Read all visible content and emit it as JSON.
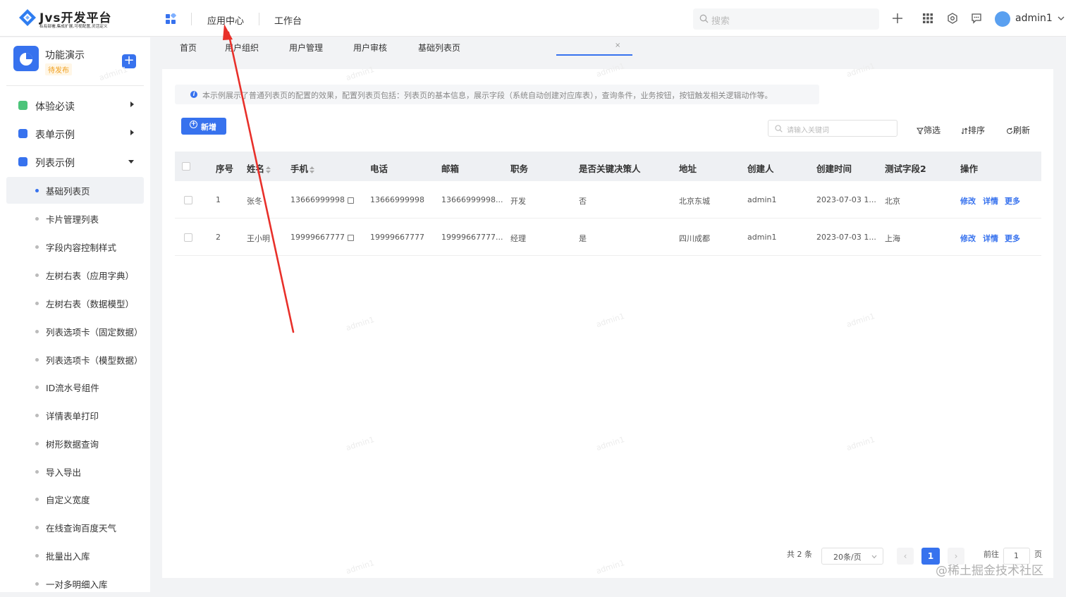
{
  "header": {
    "logo_title": "Jvs开发平台",
    "logo_subtitle": "私有部署,集成扩展,可视配置,灵活定义",
    "nav": [
      "应用中心",
      "工作台"
    ],
    "search_placeholder": "搜索",
    "username": "admin1"
  },
  "sidebar": {
    "app_name": "功能演示",
    "app_status": "待发布",
    "add_label": "+",
    "groups": [
      {
        "label": "体验必读",
        "color": "#4cc47a"
      },
      {
        "label": "表单示例",
        "color": "#3772ee"
      },
      {
        "label": "列表示例",
        "color": "#3772ee"
      }
    ],
    "items": [
      {
        "label": "基础列表页",
        "active": true
      },
      {
        "label": "卡片管理列表"
      },
      {
        "label": "字段内容控制样式"
      },
      {
        "label": "左树右表（应用字典）"
      },
      {
        "label": "左树右表（数据模型）"
      },
      {
        "label": "列表选项卡（固定数据）"
      },
      {
        "label": "列表选项卡（模型数据）"
      },
      {
        "label": "ID流水号组件"
      },
      {
        "label": "详情表单打印"
      },
      {
        "label": "树形数据查询"
      },
      {
        "label": "导入导出"
      },
      {
        "label": "自定义宽度"
      },
      {
        "label": "在线查询百度天气"
      },
      {
        "label": "批量出入库"
      },
      {
        "label": "一对多明细入库"
      }
    ]
  },
  "tabs": [
    "首页",
    "用户组织",
    "用户管理",
    "用户审核",
    "基础列表页"
  ],
  "tab_close": "×",
  "notice": "本示例展示了普通列表页的配置的效果，配置列表页包括：列表页的基本信息，展示字段（系统自动创建对应库表），查询条件，业务按钮，按钮触发相关逻辑动作等。",
  "notice_icon": "i",
  "toolbar": {
    "new_label": "新增",
    "keyword_placeholder": "请输入关键词",
    "filter_label": "筛选",
    "sort_label": "排序",
    "refresh_label": "刷新"
  },
  "table": {
    "columns": [
      "序号",
      "姓名",
      "手机",
      "电话",
      "邮箱",
      "职务",
      "是否关键决策人",
      "地址",
      "创建人",
      "创建时间",
      "测试字段2",
      "操作"
    ],
    "rows": [
      {
        "no": "1",
        "name": "张冬",
        "mobile": "13666999998",
        "phone": "13666999998",
        "email": "13666999998...",
        "title": "开发",
        "key": "否",
        "address": "北京东城",
        "creator": "admin1",
        "created": "2023-07-03 1...",
        "test2": "北京"
      },
      {
        "no": "2",
        "name": "王小明",
        "mobile": "19999667777",
        "phone": "19999667777",
        "email": "19999667777...",
        "title": "经理",
        "key": "是",
        "address": "四川成都",
        "creator": "admin1",
        "created": "2023-07-03 1...",
        "test2": "上海"
      }
    ],
    "actions": [
      "修改",
      "详情",
      "更多"
    ]
  },
  "pagination": {
    "total": "共 2 条",
    "page_size": "20条/页",
    "current": "1",
    "goto_label": "前往",
    "goto_value": "1",
    "page_unit": "页",
    "prev": "‹",
    "next": "›"
  },
  "watermark": "admin1",
  "footer_watermark": "@稀土掘金技术社区",
  "colors": {
    "primary": "#3772ee",
    "annotation_arrow": "#e8302a"
  }
}
